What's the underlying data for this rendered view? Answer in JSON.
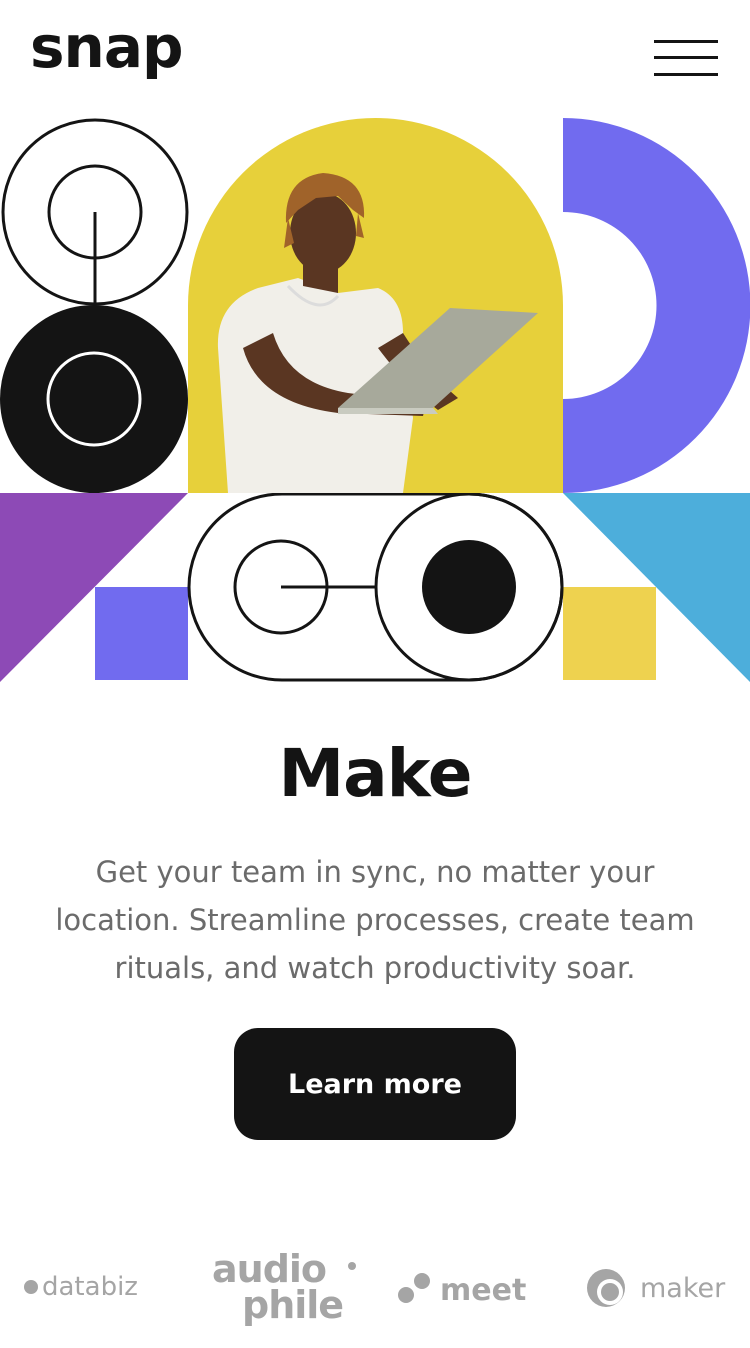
{
  "header": {
    "logo_text": "snap",
    "menu_icon": "hamburger-menu-icon"
  },
  "hero": {
    "image_description_icon": "person-with-laptop-photo",
    "colors": {
      "purple": "#8d4ab6",
      "indigo": "#716bef",
      "yellow": "#eed24f",
      "blue": "#4daedb",
      "photo_bg": "#e7d03a",
      "dark": "#141414"
    }
  },
  "main": {
    "title": "Make",
    "description": "Get your team in sync, no matter your location. Streamline processes, create team rituals, and watch productivity soar.",
    "cta_label": "Learn more"
  },
  "clients": {
    "databiz": "databiz",
    "audiophile_line1": "audio",
    "audiophile_line2": "phile",
    "meet": "meet",
    "maker": "maker"
  }
}
